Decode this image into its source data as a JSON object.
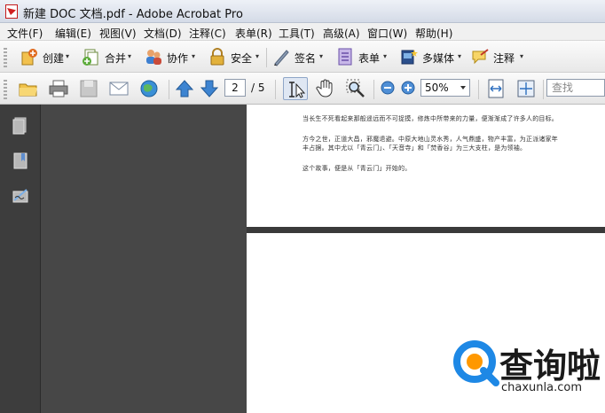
{
  "window": {
    "title": "新建 DOC 文档.pdf - Adobe Acrobat Pro"
  },
  "menu": [
    "文件(F)",
    "编辑(E)",
    "视图(V)",
    "文档(D)",
    "注释(C)",
    "表单(R)",
    "工具(T)",
    "高级(A)",
    "窗口(W)",
    "帮助(H)"
  ],
  "toolbar1": {
    "create": "创建",
    "combine": "合并",
    "collaborate": "协作",
    "secure": "安全",
    "sign": "签名",
    "forms": "表单",
    "multimedia": "多媒体",
    "comment": "注释"
  },
  "toolbar2": {
    "page_current": "2",
    "page_total": "/ 5",
    "zoom": "50%",
    "find_placeholder": "查找"
  },
  "document": {
    "lines": [
      "当长生不死看起来那般遥远而不可捉摸，修炼中所带来的力量，便渐渐成了许多人的目标。",
      "方今之世，正道大昌，邪魔退避。中原大地山灵水秀，人气鼎盛，物产丰富，为正派诸家年",
      "丰占据。其中尤以「青云门」、「天音寺」和「焚香谷」为三大支柱，是为领袖。",
      "这个故事，便是从「青云门」开始的。"
    ]
  },
  "watermark": {
    "name": "查询啦",
    "url": "chaxunla.com"
  },
  "colors": {
    "accent_blue": "#1e88e5",
    "toolbar_bg": "#eeeeee",
    "dark_pane": "#3d3d3d"
  }
}
